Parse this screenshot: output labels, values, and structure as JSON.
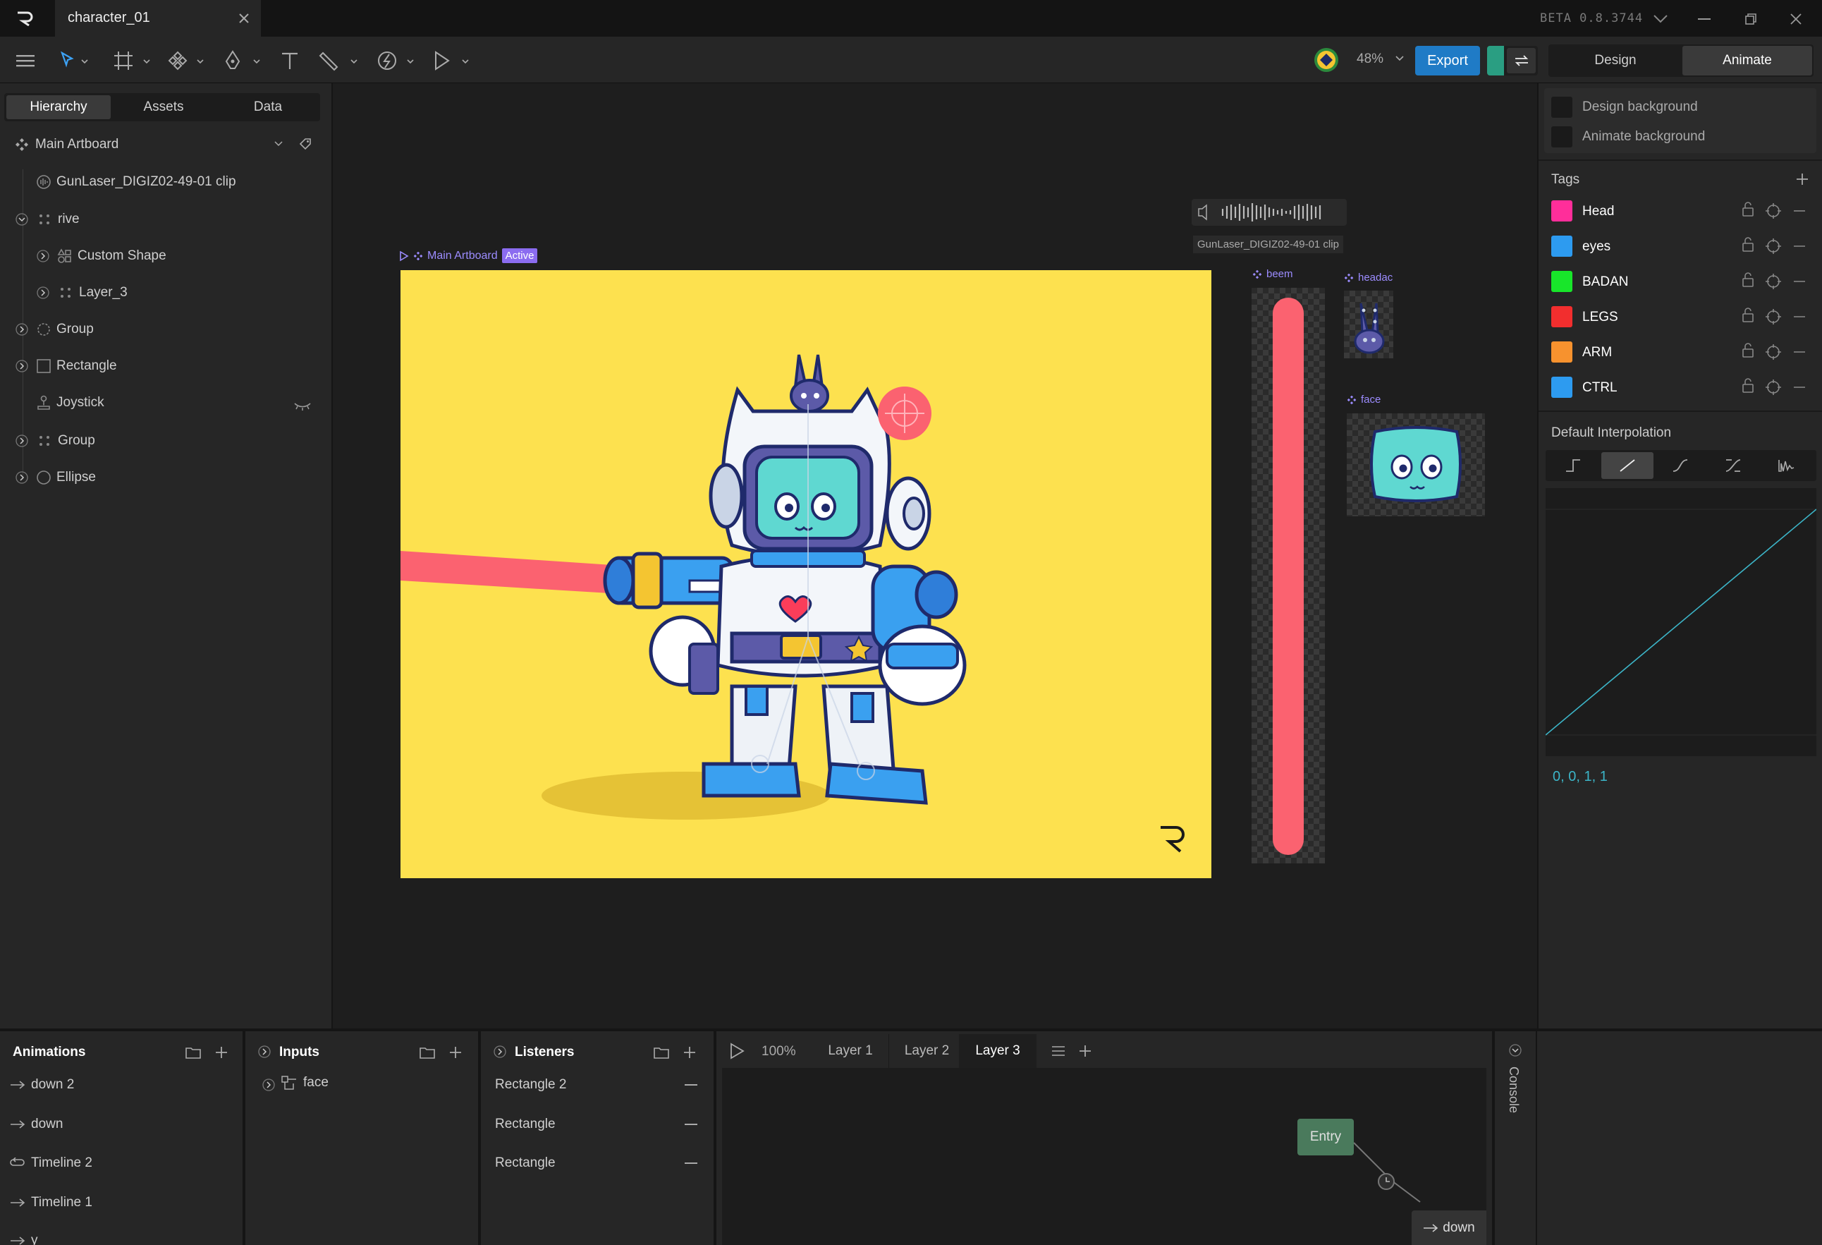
{
  "window": {
    "tab_title": "character_01",
    "version": "BETA 0.8.3744"
  },
  "toolbar": {
    "zoom": "48%",
    "export_label": "Export",
    "mode_design": "Design",
    "mode_animate": "Animate"
  },
  "left_panel": {
    "tabs": [
      "Hierarchy",
      "Assets",
      "Data"
    ],
    "artboard_name": "Main Artboard",
    "tree": [
      {
        "label": "GunLaser_DIGIZ02-49-01 clip"
      },
      {
        "label": "rive"
      },
      {
        "label": "Custom Shape"
      },
      {
        "label": "Layer_3"
      },
      {
        "label": "Group"
      },
      {
        "label": "Rectangle"
      },
      {
        "label": "Joystick"
      },
      {
        "label": "Group"
      },
      {
        "label": "Ellipse"
      }
    ]
  },
  "canvas": {
    "artboard_label": "Main Artboard",
    "active_badge": "Active",
    "audio_clip_label": "GunLaser_DIGIZ02-49-01 clip",
    "small_artboards": [
      "beem",
      "headac",
      "face"
    ],
    "colors": {
      "artboard_bg": "#fde14f",
      "laser": "#fb6270",
      "robot_blue": "#3aa0f0",
      "screen": "#5fd8d1"
    }
  },
  "right_panel": {
    "backgrounds": [
      "Design background",
      "Animate background"
    ],
    "tags_title": "Tags",
    "tags": [
      {
        "name": "Head",
        "color": "#ff2e9a"
      },
      {
        "name": "eyes",
        "color": "#2d9bf0"
      },
      {
        "name": "BADAN",
        "color": "#18e62a"
      },
      {
        "name": "LEGS",
        "color": "#f22e2e"
      },
      {
        "name": "ARM",
        "color": "#f7922e"
      },
      {
        "name": "CTRL",
        "color": "#2d9bf0"
      }
    ],
    "interpolation_title": "Default Interpolation",
    "curve_values": "0, 0, 1, 1"
  },
  "bottom": {
    "animations_title": "Animations",
    "animations": [
      "down 2",
      "down",
      "Timeline 2",
      "Timeline 1",
      "y"
    ],
    "inputs_title": "Inputs",
    "inputs": [
      "face"
    ],
    "listeners_title": "Listeners",
    "listeners": [
      "Rectangle 2",
      "Rectangle",
      "Rectangle"
    ],
    "state_zoom": "100%",
    "layers": [
      "Layer 1",
      "Layer 2",
      "Layer 3"
    ],
    "entry_label": "Entry",
    "down_label": "down",
    "console_label": "Console"
  }
}
